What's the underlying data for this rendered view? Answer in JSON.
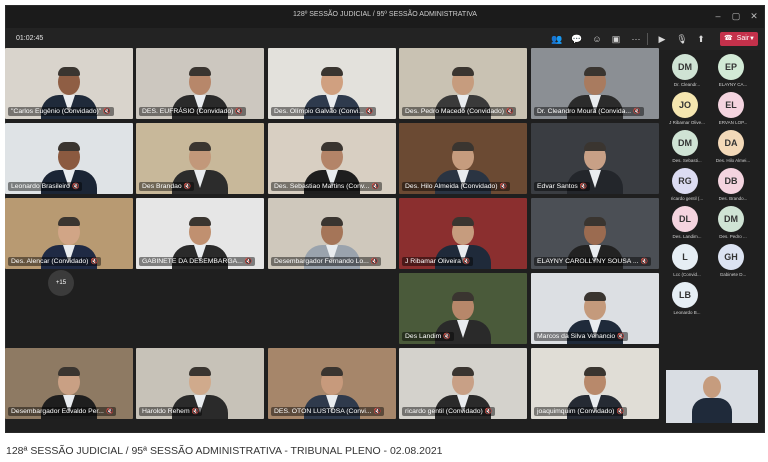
{
  "window": {
    "title": "128º SESSÃO JUDICIAL / 95º SESSÃO ADMINISTRATIVA",
    "timer": "01:02:45",
    "leave_label": "Sair"
  },
  "tiles": [
    {
      "name": "\"Carlos Eugênio (Convidado)\"",
      "wall": "#d9d4cc",
      "suit": "#1f2a3a",
      "skin": "#8f5e44"
    },
    {
      "name": "DES. EUFRÁSIO (Convidado)",
      "wall": "#ccc7bf",
      "suit": "#2a2a2a",
      "skin": "#b7876a"
    },
    {
      "name": "Des. Olímpio Galvão (Convi...",
      "wall": "#e3e1dc",
      "suit": "#2e3a4d",
      "skin": "#d0a080"
    },
    {
      "name": "Des. Pedro Macedo (Convidado)",
      "wall": "#c9c2b3",
      "suit": "#3a3a3a",
      "skin": "#c69c7e"
    },
    {
      "name": "Dr. Cleandro Moura (Convida...",
      "wall": "#8b8f94",
      "suit": "#2b2b2b",
      "skin": "#a97b5f"
    },
    {
      "name": "Leonardo Brasileiro",
      "wall": "#dfe3e6",
      "suit": "#1b2535",
      "skin": "#8b5a40"
    },
    {
      "name": "Des Brandao",
      "wall": "#c8b89a",
      "suit": "#2c2c2c",
      "skin": "#c2987a"
    },
    {
      "name": "Des. Sebastiao Martins (Conv...",
      "wall": "#d8cfc2",
      "suit": "#1e1e1e",
      "skin": "#b38468"
    },
    {
      "name": "Des. Hilo Almeida (Convidado)",
      "wall": "#6b4a33",
      "suit": "#2a3442",
      "skin": "#c69c7e"
    },
    {
      "name": "Edvar Santos",
      "wall": "#3a3d42",
      "suit": "#23262b",
      "skin": "#c8a086"
    },
    {
      "name": "Des. Alencar (Convidado)",
      "wall": "#b89a72",
      "suit": "#1f2a44",
      "skin": "#d1a586"
    },
    {
      "name": "GABINETE DA DESEMBARGA...",
      "wall": "#e6e6e6",
      "suit": "#2a2a2a",
      "skin": "#c09070"
    },
    {
      "name": "Desembargador Fernando Lo...",
      "wall": "#cfc8bc",
      "suit": "#9aa3ad",
      "skin": "#a57558"
    },
    {
      "name": "J Ribamar Oliveira",
      "wall": "#8b2f2f",
      "suit": "#1f2a3a",
      "skin": "#c69c7e"
    },
    {
      "name": "ELAYNY CAROLLYNY SOUSA ...",
      "wall": "#4b4f55",
      "suit": "#222222",
      "skin": "#9b6b50"
    },
    {
      "name": "Desembargador Edvaldo Per...",
      "wall": "#8e7a63",
      "suit": "#1e1e1e",
      "skin": "#c9a084"
    },
    {
      "name": "Haroldo Rehem",
      "wall": "#c7c2b8",
      "suit": "#2a2a2a",
      "skin": "#d0aa8c"
    },
    {
      "name": "DES. OTON LUSTOSA (Convi...",
      "wall": "#a6866a",
      "suit": "#2f3a4c",
      "skin": "#c79a7c"
    },
    {
      "name": "Des Landim",
      "wall": "#4a5a3a",
      "suit": "#2a2a2a",
      "skin": "#b7876a"
    },
    {
      "name": "Marcos da Silva Venancio",
      "wall": "#dcdfe3",
      "suit": "#1f2a3a",
      "skin": "#c49a7c"
    },
    {
      "name": "ricardo gentil (Convidado)",
      "wall": "#d4d2cc",
      "suit": "#2a2a2a",
      "skin": "#c8a086"
    },
    {
      "name": "joaquimquim (Convidado)",
      "wall": "#e0ddd6",
      "suit": "#252a33",
      "skin": "#b8896b"
    }
  ],
  "roster": [
    {
      "initials": "DM",
      "label": "Dr. Cleandr...",
      "bg": "#cfe3d4"
    },
    {
      "initials": "EP",
      "label": "ELAYNY CA...",
      "bg": "#d2ead6"
    },
    {
      "initials": "JO",
      "label": "J Ribamar Olive...",
      "bg": "#f5e6b0"
    },
    {
      "initials": "EL",
      "label": "ERVAN LOP...",
      "bg": "#f4d4df"
    },
    {
      "initials": "DM",
      "label": "Des. Sebasti...",
      "bg": "#cfe3d4"
    },
    {
      "initials": "DA",
      "label": "Des. Hilo Almei...",
      "bg": "#f3d9b8"
    },
    {
      "initials": "RG",
      "label": "ricardo gentil (...",
      "bg": "#dcdcf2"
    },
    {
      "initials": "DB",
      "label": "Des. Brando...",
      "bg": "#f4d4df"
    },
    {
      "initials": "DL",
      "label": "Des. Landim...",
      "bg": "#f4d4df"
    },
    {
      "initials": "DM",
      "label": "Des. Pedro ...",
      "bg": "#cfe3d4"
    },
    {
      "initials": "L",
      "label": "Lcc (Convid...",
      "bg": "#e6eef4"
    },
    {
      "initials": "GH",
      "label": "Gabinete D...",
      "bg": "#dce3f2"
    },
    {
      "initials": "LB",
      "label": "Leonardo B...",
      "bg": "#e6eef4"
    }
  ],
  "more_label": "+15",
  "caption": "128ª SESSÃO JUDICIAL / 95ª SESSÃO ADMINISTRATIVA - TRIBUNAL PLENO - 02.08.2021"
}
